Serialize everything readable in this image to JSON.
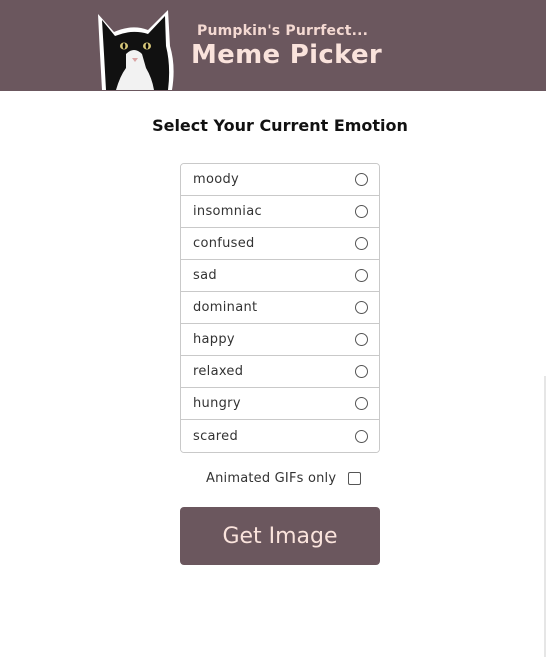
{
  "header": {
    "subtitle": "Pumpkin's Purrfect...",
    "title": "Meme Picker",
    "logo_icon": "cat-photo-icon",
    "background_color": "#6b575e",
    "text_color": "#fae3dc"
  },
  "main": {
    "heading": "Select Your Current Emotion",
    "emotions": [
      {
        "label": "moody"
      },
      {
        "label": "insomniac"
      },
      {
        "label": "confused"
      },
      {
        "label": "sad"
      },
      {
        "label": "dominant"
      },
      {
        "label": "happy"
      },
      {
        "label": "relaxed"
      },
      {
        "label": "hungry"
      },
      {
        "label": "scared"
      }
    ],
    "gif_option_label": "Animated GIFs only",
    "gif_option_checked": false,
    "get_image_label": "Get Image",
    "button_color": "#6b575e"
  }
}
